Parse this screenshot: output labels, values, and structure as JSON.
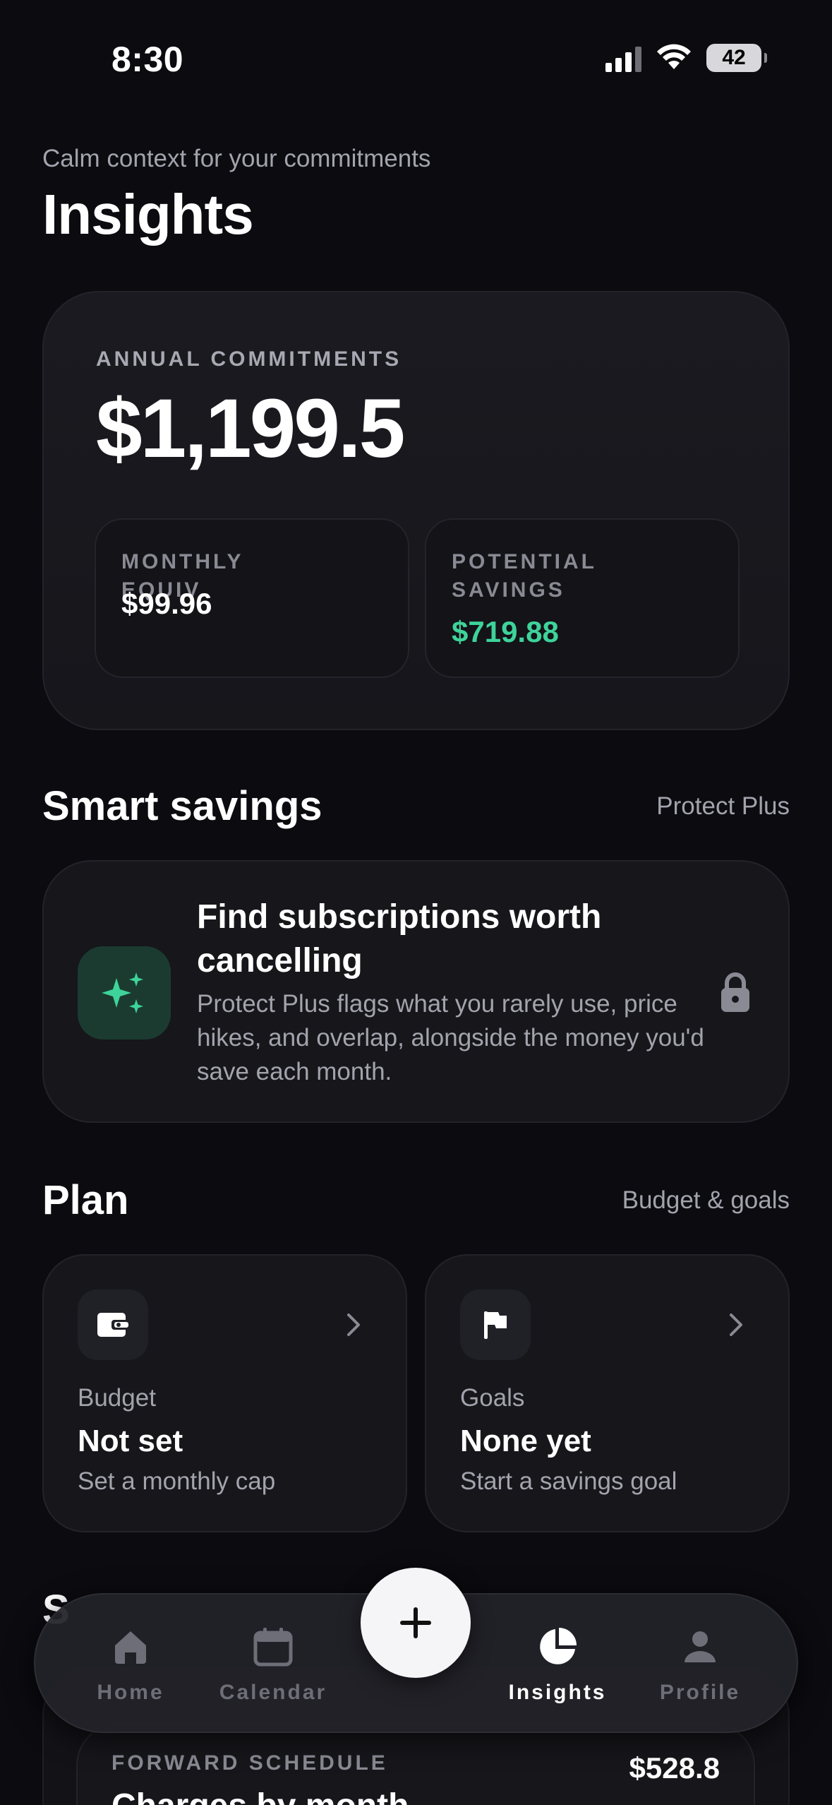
{
  "status_bar": {
    "time": "8:30",
    "battery": "42"
  },
  "header": {
    "subtitle": "Calm context for your commitments",
    "title": "Insights"
  },
  "summary": {
    "label": "ANNUAL COMMITMENTS",
    "value": "$1,199.5",
    "monthly": {
      "label": "MONTHLY EQUIV.",
      "value": "$99.96"
    },
    "savings": {
      "label": "POTENTIAL SAVINGS",
      "value": "$719.88"
    }
  },
  "smart_savings": {
    "title": "Smart savings",
    "link": "Protect Plus",
    "card_heading": "Find subscriptions worth cancelling",
    "card_body": "Protect Plus flags what you rarely use, price hikes, and overlap, alongside the money you'd save each month."
  },
  "plan": {
    "title": "Plan",
    "link": "Budget & goals",
    "budget": {
      "label": "Budget",
      "value": "Not set",
      "hint": "Set a monthly cap"
    },
    "goals": {
      "label": "Goals",
      "value": "None yet",
      "hint": "Start a savings goal"
    }
  },
  "schedule": {
    "section_initial": "S",
    "label": "FORWARD SCHEDULE",
    "title": "Charges by month",
    "total": "$528.8"
  },
  "tab_bar": {
    "home": "Home",
    "calendar": "Calendar",
    "insights": "Insights",
    "profile": "Profile",
    "active": "insights"
  },
  "colors": {
    "accent_green": "#3ed39a",
    "background": "#0b0b10",
    "card": "#16161b"
  },
  "icons": [
    "sparkles-icon",
    "lock-icon",
    "wallet-icon",
    "flag-icon",
    "chevron-right-icon",
    "home-icon",
    "calendar-icon",
    "pie-chart-icon",
    "person-icon",
    "plus-icon"
  ]
}
